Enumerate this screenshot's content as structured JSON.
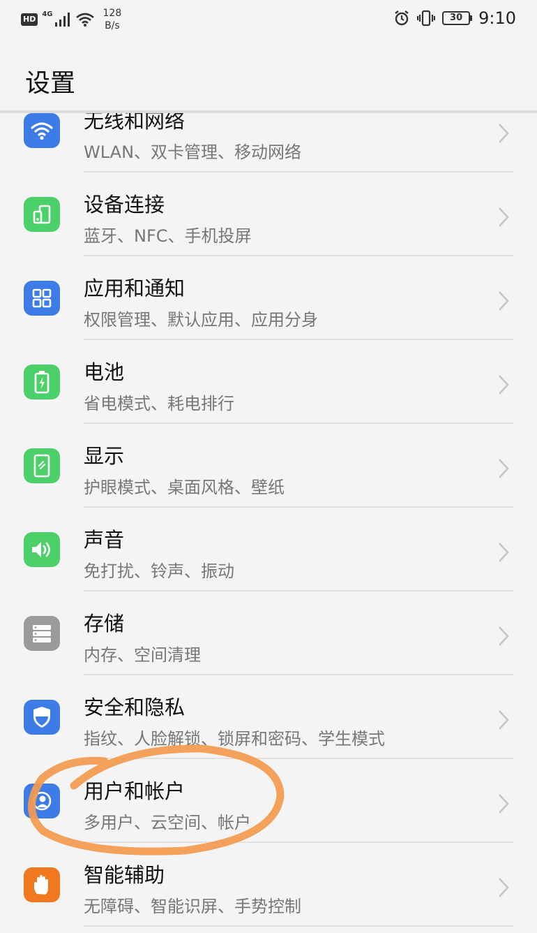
{
  "status_bar": {
    "hd": "HD",
    "network": "4G",
    "speed_value": "128",
    "speed_unit": "B/s",
    "battery": "30",
    "time": "9:10"
  },
  "header": {
    "title": "设置"
  },
  "colors": {
    "blue_tile": "#3d7be6",
    "green_tile": "#4cd16a",
    "gray_tile": "#9b9b9b",
    "orange_tile": "#f0781e",
    "annotation_orange": "#f39a4d"
  },
  "settings": {
    "items": [
      {
        "title": "无线和网络",
        "subtitle": "WLAN、双卡管理、移动网络",
        "icon": "wifi-icon"
      },
      {
        "title": "设备连接",
        "subtitle": "蓝牙、NFC、手机投屏",
        "icon": "device-connection-icon"
      },
      {
        "title": "应用和通知",
        "subtitle": "权限管理、默认应用、应用分身",
        "icon": "apps-icon"
      },
      {
        "title": "电池",
        "subtitle": "省电模式、耗电排行",
        "icon": "battery-icon"
      },
      {
        "title": "显示",
        "subtitle": "护眼模式、桌面风格、壁纸",
        "icon": "display-icon"
      },
      {
        "title": "声音",
        "subtitle": "免打扰、铃声、振动",
        "icon": "sound-icon"
      },
      {
        "title": "存储",
        "subtitle": "内存、空间清理",
        "icon": "storage-icon"
      },
      {
        "title": "安全和隐私",
        "subtitle": "指纹、人脸解锁、锁屏和密码、学生模式",
        "icon": "security-icon"
      },
      {
        "title": "用户和帐户",
        "subtitle": "多用户、云空间、帐户",
        "icon": "users-icon"
      },
      {
        "title": "智能辅助",
        "subtitle": "无障碍、智能识屏、手势控制",
        "icon": "assist-icon"
      }
    ]
  }
}
